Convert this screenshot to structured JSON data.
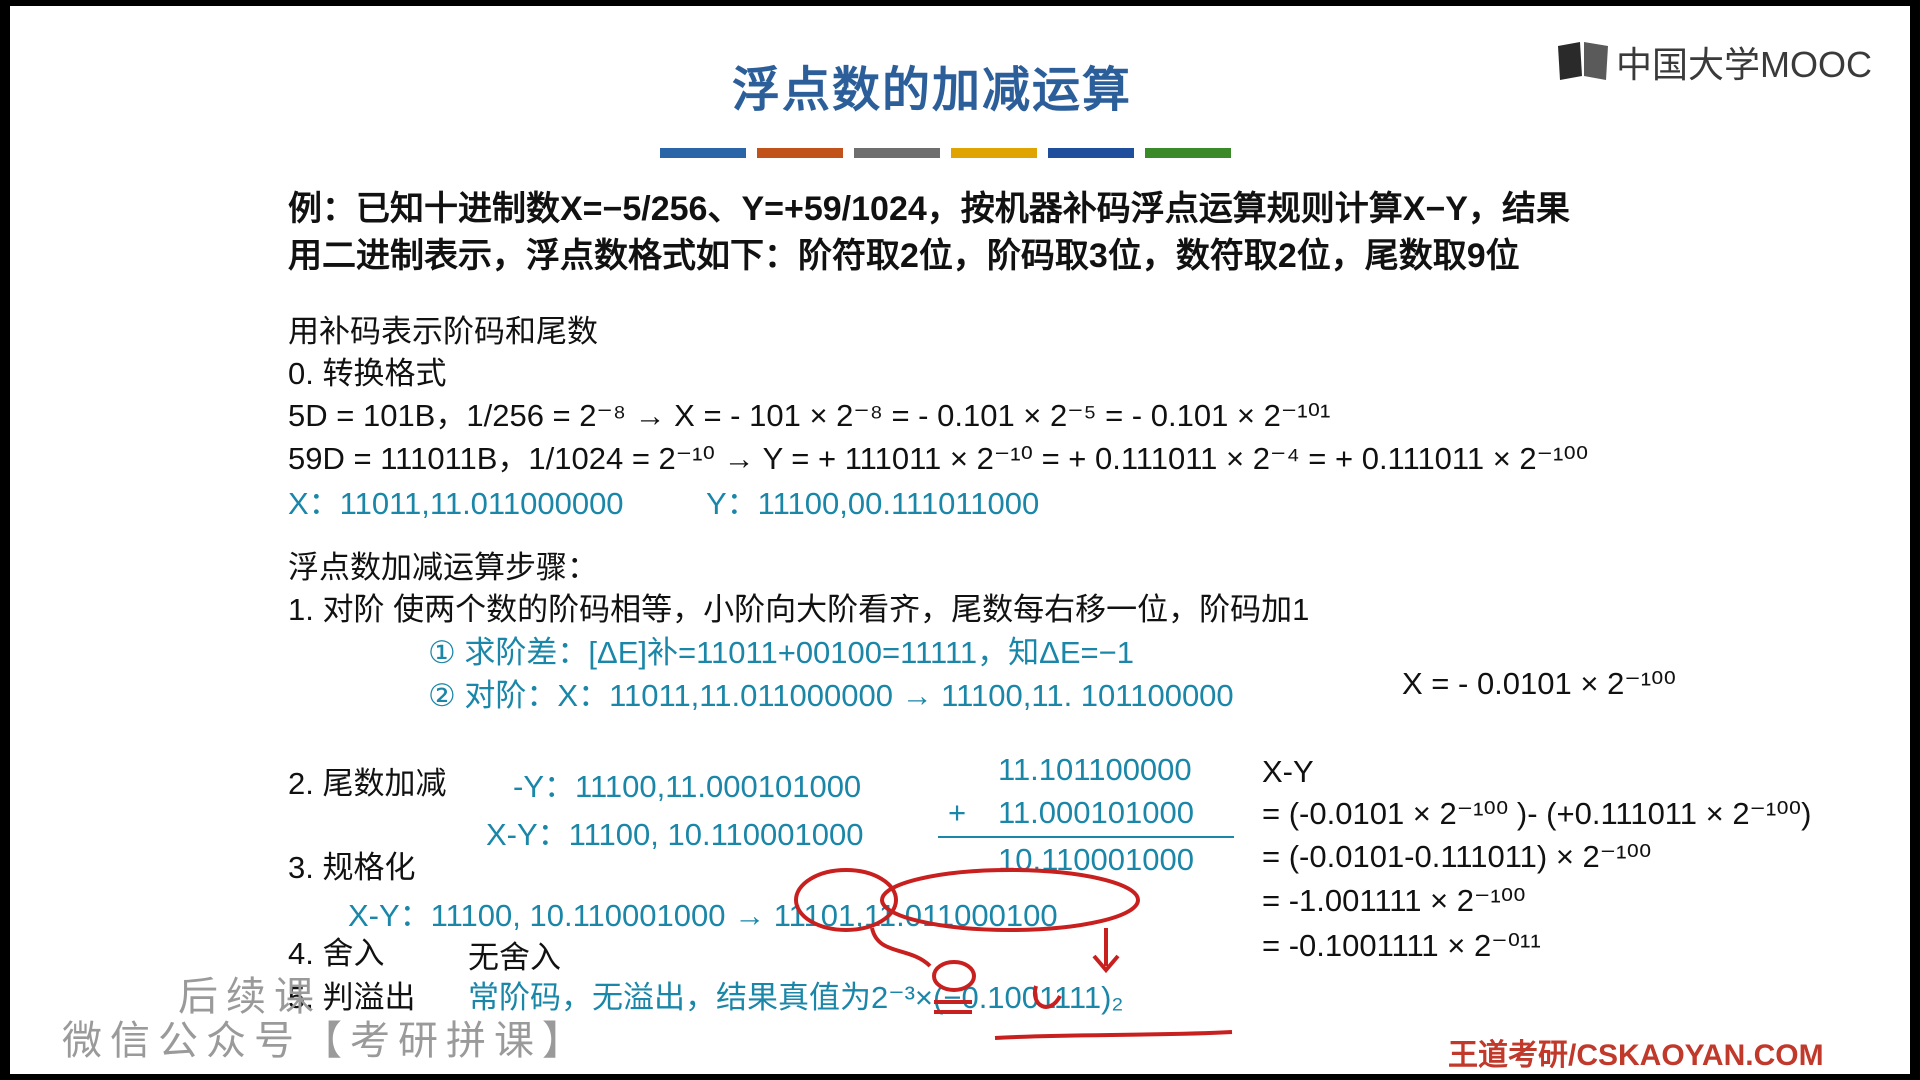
{
  "header": {
    "title": "浮点数的加减运算",
    "logo": "中国大学MOOC",
    "colors": [
      "#2a65a8",
      "#c0521a",
      "#6e6e6e",
      "#e0a400",
      "#1f4f9c",
      "#3a8a2a"
    ]
  },
  "problem": {
    "line1": "例：已知十进制数X=−5/256、Y=+59/1024，按机器补码浮点运算规则计算X−Y，结果",
    "line2": "用二进制表示，浮点数格式如下：阶符取2位，阶码取3位，数符取2位，尾数取9位"
  },
  "section0": {
    "intro": "用补码表示阶码和尾数",
    "heading": "0.  转换格式",
    "x_line": "5D = 101B，1/256 = 2⁻⁸ → X = - 101 × 2⁻⁸ = - 0.101 × 2⁻⁵ = - 0.101 × 2⁻¹⁰¹",
    "y_line": "59D = 111011B，1/1024 = 2⁻¹⁰ → Y = + 111011 × 2⁻¹⁰ = + 0.111011 × 2⁻⁴ = + 0.111011 × 2⁻¹⁰⁰",
    "x_code": "X：11011,11.011000000",
    "y_code": "Y：11100,00.111011000"
  },
  "steps": {
    "heading": "浮点数加减运算步骤：",
    "step1": "1.   对阶  使两个数的阶码相等，小阶向大阶看齐，尾数每右移一位，阶码加1",
    "step1a": "① 求阶差：[ΔE]补=11011+00100=11111，知ΔE=−1",
    "step1b": "② 对阶：X：11011,11.011000000  →  11100,11. 101100000",
    "step1_result": "X = - 0.0101 × 2⁻¹⁰⁰",
    "step2_label": "2.   尾数加减",
    "neg_y": "-Y：11100,11.000101000",
    "x_minus_y": "X-Y：11100, 10.110001000",
    "add_top": "11.101100000",
    "add_plus": "+",
    "add_second": "11.000101000",
    "add_result": "10.110001000",
    "step3_label": "3.   规格化",
    "normalize": "X-Y：11100, 10.110001000  →  11101,11.011000100",
    "step4_label": "4.  舍入",
    "step4_text": "无舍入",
    "step5_label": "5.  判溢出",
    "step5_text": "常阶码，无溢出，结果真值为2⁻³×(−0.1001111)₂"
  },
  "derivation": {
    "head": "X-Y",
    "l1": "= (-0.0101 × 2⁻¹⁰⁰ )- (+0.111011 × 2⁻¹⁰⁰)",
    "l2": "= (-0.0101-0.111011) × 2⁻¹⁰⁰",
    "l3": "= -1.001111 × 2⁻¹⁰⁰",
    "l4": "= -0.1001111 × 2⁻⁰¹¹"
  },
  "watermark": {
    "line1": "后续课",
    "line2": "微信公众号【考研拼课】"
  },
  "footer": "王道考研/CSKAOYAN.COM"
}
